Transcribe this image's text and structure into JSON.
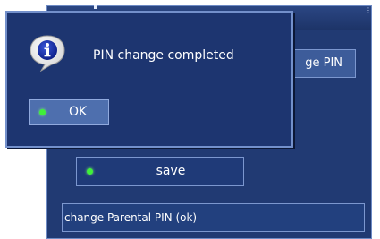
{
  "colors": {
    "window_bg": "#213a73",
    "popup_bg": "#1d3570",
    "border": "#7c97cf",
    "led_green": "#3ff03a",
    "text": "#ffffff"
  },
  "settings_window": {
    "change_pin_label": "ge PIN",
    "save_label": "save",
    "status_text": "change Parental PIN (ok)"
  },
  "popup": {
    "icon": "info-icon",
    "message": "PIN change completed",
    "ok_label": "OK"
  }
}
